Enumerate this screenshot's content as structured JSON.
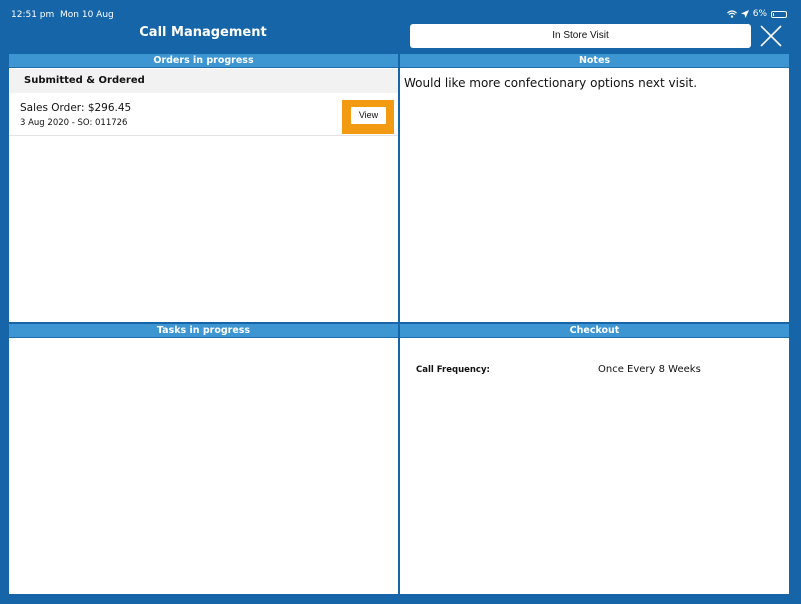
{
  "status_bar": {
    "time": "12:51 pm",
    "date": "Mon 10 Aug",
    "battery": "6%",
    "battery_level": 0.06
  },
  "header": {
    "title": "Call Management",
    "visit_type": "In Store Visit",
    "close_icon": "close-icon"
  },
  "orders": {
    "header": "Orders in progress",
    "section": "Submitted & Ordered",
    "items": [
      {
        "title": "Sales Order: $296.45",
        "subtitle": "3 Aug 2020 - SO: 011726",
        "view_label": "View"
      }
    ]
  },
  "notes": {
    "header": "Notes",
    "text": "Would like more confectionary options next visit."
  },
  "tasks": {
    "header": "Tasks in progress"
  },
  "checkout": {
    "header": "Checkout",
    "label": "Call Frequency:",
    "value": "Once Every 8 Weeks"
  },
  "colors": {
    "frame": "#1565a8",
    "panel_header": "#3d95d1",
    "highlight": "#f29a12"
  }
}
